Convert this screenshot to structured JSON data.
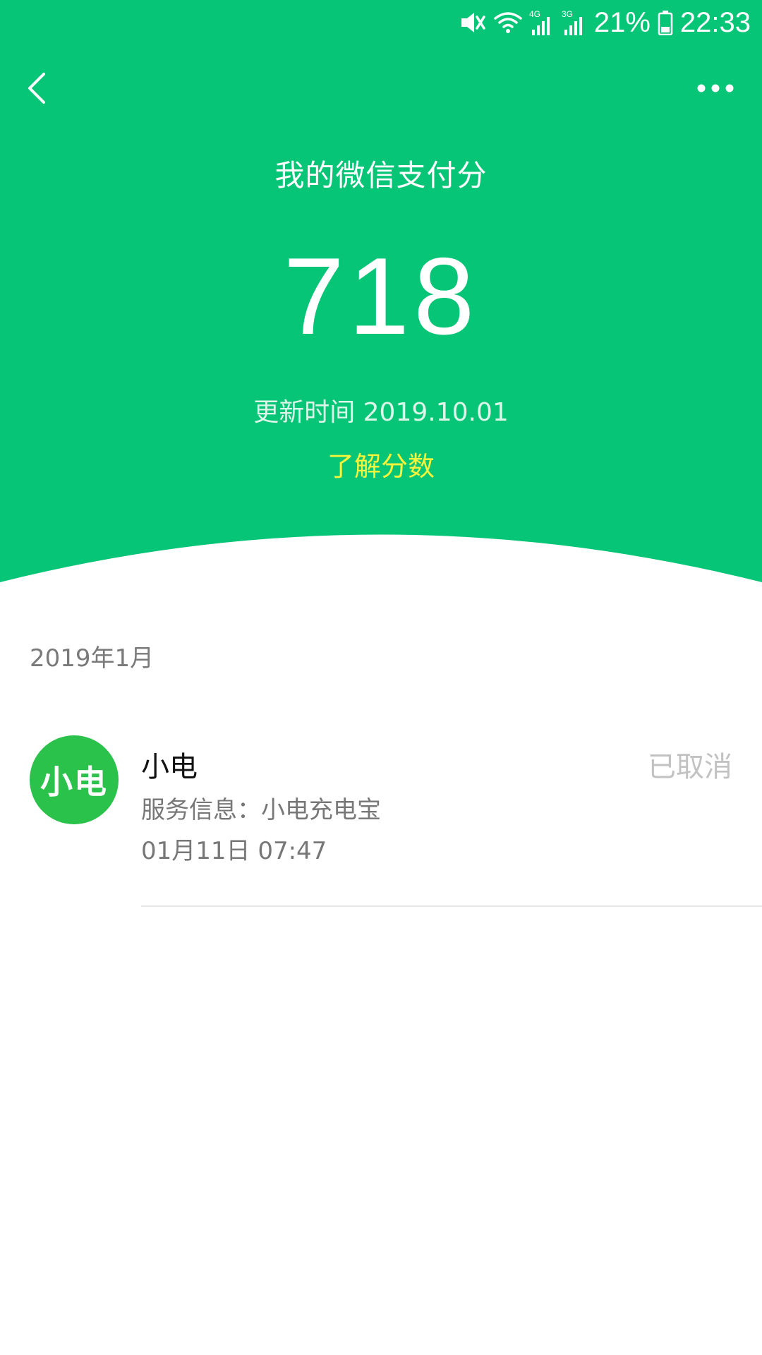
{
  "status_bar": {
    "battery": "21%",
    "time": "22:33",
    "network_1": "4G",
    "network_2": "3G",
    "icons": [
      "mute-icon",
      "wifi-icon",
      "signal-4g-icon",
      "signal-3g-icon",
      "battery-icon"
    ]
  },
  "nav": {
    "back_icon": "chevron-left-icon",
    "more_icon": "more-dots-icon"
  },
  "header": {
    "title": "我的微信支付分",
    "score": "718",
    "updated": "更新时间 2019.10.01",
    "learn_link": "了解分数"
  },
  "records": {
    "section_title": "2019年1月",
    "items": [
      {
        "avatar_text": "小电",
        "name": "小电",
        "status": "已取消",
        "service": "服务信息：小电充电宝",
        "time": "01月11日 07:47"
      }
    ]
  },
  "colors": {
    "brand_green": "#07C576",
    "avatar_green": "#2BC24B",
    "link_yellow": "#F7F43B"
  }
}
